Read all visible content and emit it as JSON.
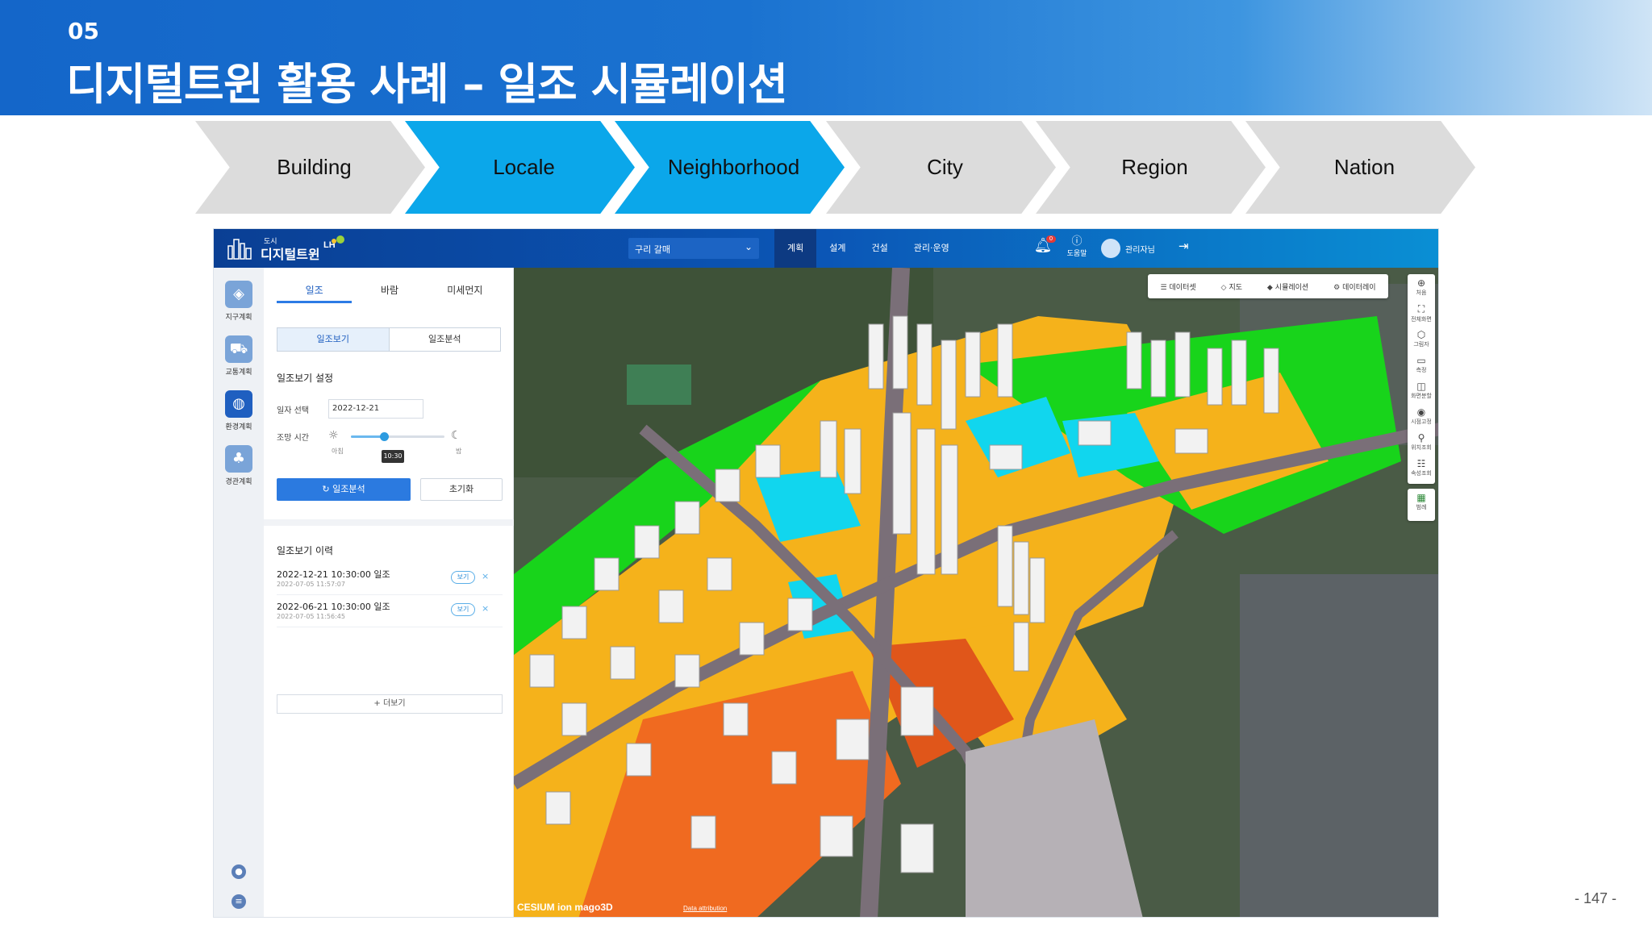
{
  "slide": {
    "section_number": "05",
    "title": "디지털트윈 활용 사례 – 일조 시뮬레이션",
    "page_number": "- 147 -"
  },
  "scales": [
    {
      "label": "Building",
      "active": false
    },
    {
      "label": "Locale",
      "active": true
    },
    {
      "label": "Neighborhood",
      "active": true
    },
    {
      "label": "City",
      "active": false
    },
    {
      "label": "Region",
      "active": false
    },
    {
      "label": "Nation",
      "active": false
    }
  ],
  "colors": {
    "banner": "#1466c9",
    "chevron_active": "#0ba7ea",
    "chevron_inactive": "#dcdcdc",
    "topbar": "#0b56b6",
    "accent": "#2b7ae0",
    "zone_green": "#18d41b",
    "zone_orange": "#f5b21b",
    "zone_cyan": "#11d6ee",
    "zone_red": "#f06a20"
  },
  "app": {
    "logo_small": "도시",
    "logo_text": "디지털트윈",
    "logo_lh": "LH",
    "region": "구리 갈매",
    "nav": [
      "계획",
      "설계",
      "건설",
      "관리·운영"
    ],
    "nav_active": "계획",
    "notification_badge": "0",
    "help_label": "도움말",
    "username": "관리자님",
    "icons": {
      "notification": "bell-icon",
      "help": "question-icon",
      "logout": "logout-icon",
      "region": "chevron-down-icon"
    }
  },
  "rail": [
    {
      "label": "지구계획",
      "icon": "layers-icon",
      "active": false
    },
    {
      "label": "교통계획",
      "icon": "car-icon",
      "active": false
    },
    {
      "label": "환경계획",
      "icon": "globe-icon",
      "active": true
    },
    {
      "label": "경관계획",
      "icon": "trees-icon",
      "active": false
    }
  ],
  "panel": {
    "tabs": [
      "일조",
      "바람",
      "미세먼지"
    ],
    "active_tab": "일조",
    "segments": [
      "일조보기",
      "일조분석"
    ],
    "active_segment": "일조보기",
    "settings_title": "일조보기 설정",
    "date_label": "일자 선택",
    "date_value": "2022-12-21",
    "time_label": "조망 시간",
    "time_start_label": "아침",
    "time_end_label": "밤",
    "time_value": "10:30",
    "time_fraction": 0.35,
    "analyze_button": "일조분석",
    "reset_button": "초기화",
    "history_title": "일조보기 이력",
    "history": [
      {
        "title": "2022-12-21 10:30:00 일조",
        "created": "2022-07-05 11:57:07",
        "view": "보기"
      },
      {
        "title": "2022-06-21 10:30:00 일조",
        "created": "2022-07-05 11:56:45",
        "view": "보기"
      }
    ],
    "more_button": "+ 더보기"
  },
  "map": {
    "toolbar": [
      {
        "label": "데이터셋",
        "icon": "list-icon"
      },
      {
        "label": "지도",
        "icon": "map-layer-icon"
      },
      {
        "label": "시뮬레이션",
        "icon": "cube-icon"
      },
      {
        "label": "데이터레이",
        "icon": "gear-icon"
      }
    ],
    "tools": [
      {
        "label": "처음",
        "icon": "target-icon"
      },
      {
        "label": "전체화면",
        "icon": "fullscreen-icon"
      },
      {
        "label": "그림자",
        "icon": "shadow-icon"
      },
      {
        "label": "측정",
        "icon": "ruler-icon"
      },
      {
        "label": "화면분할",
        "icon": "split-icon"
      },
      {
        "label": "시점고정",
        "icon": "eye-icon"
      },
      {
        "label": "위치조회",
        "icon": "pin-icon"
      },
      {
        "label": "속성조회",
        "icon": "attributes-icon"
      }
    ],
    "legend_label": "범례",
    "attribution": "CESIUM ion  mago3D",
    "data_attribution": "Data attribution"
  }
}
